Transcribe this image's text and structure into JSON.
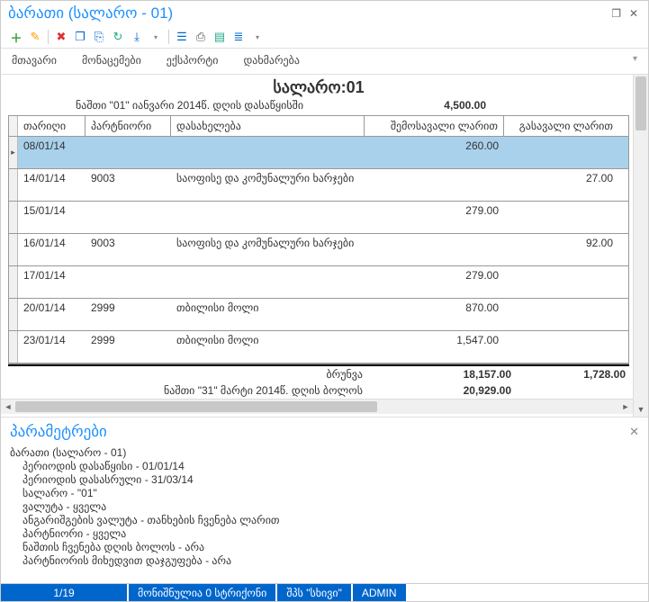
{
  "window": {
    "title": "ბარათი (სალარო - 01)"
  },
  "menu": {
    "main": "მთავარი",
    "data": "მონაცემები",
    "export": "ექსპორტი",
    "help": "დახმარება"
  },
  "report": {
    "title_prefix": "სალარო:",
    "title_value": "01",
    "opening_label": "ნაშთი \"01\" იანვარი 2014წ. დღის დასაწყისში",
    "opening_value": "4,500.00",
    "columns": {
      "date": "თარიღი",
      "partner": "პარტნიორი",
      "name": "დასახელება",
      "income": "შემოსავალი ლარით",
      "outgo": "გასავალი ლარით"
    },
    "rows": [
      {
        "date": "08/01/14",
        "partner": "",
        "name": "",
        "income": "260.00",
        "outgo": "",
        "selected": true,
        "h": "s"
      },
      {
        "date": "14/01/14",
        "partner": "9003",
        "name": "საოფისე და კომუნალური ხარჯები",
        "income": "",
        "outgo": "27.00"
      },
      {
        "date": "15/01/14",
        "partner": "",
        "name": "",
        "income": "279.00",
        "outgo": ""
      },
      {
        "date": "16/01/14",
        "partner": "9003",
        "name": "საოფისე და კომუნალური ხარჯები",
        "income": "",
        "outgo": "92.00"
      },
      {
        "date": "17/01/14",
        "partner": "",
        "name": "",
        "income": "279.00",
        "outgo": ""
      },
      {
        "date": "20/01/14",
        "partner": "2999",
        "name": "თბილისი მოლი",
        "income": "870.00",
        "outgo": ""
      },
      {
        "date": "23/01/14",
        "partner": "2999",
        "name": "თბილისი მოლი",
        "income": "1,547.00",
        "outgo": ""
      }
    ],
    "turnover_label": "ბრუნვა",
    "turnover_in": "18,157.00",
    "turnover_out": "1,728.00",
    "closing_label": "ნაშთი \"31\" მარტი 2014წ. დღის ბოლოს",
    "closing_value": "20,929.00"
  },
  "params": {
    "title": "პარამეტრები",
    "lines": [
      "ბარათი (სალარო - 01)",
      "პერიოდის დასაწყისი  - 01/01/14",
      "პერიოდის დასასრული  - 31/03/14",
      "სალარო  - \"01\"",
      "ვალუტა  - ყველა",
      "ანგარიშგების ვალუტა  - თანხების ჩვენება ლარით",
      "პარტნიორი  - ყველა",
      "ნაშთის ჩვენება დღის ბოლოს  - არა",
      "პარტნიორის მიხედვით დაჯგუფება  - არა"
    ]
  },
  "status": {
    "pos": "1/19",
    "marked": "მონიშნულია 0 სტრიქონი",
    "company": "შპს \"სხივი\"",
    "user": "ADMIN"
  },
  "icons": {
    "add": "＋",
    "edit": "✎",
    "delete": "✖",
    "copy": "❐",
    "dup": "⎘",
    "refresh": "↻",
    "export": "⤓",
    "preview": "☰",
    "print": "⎙",
    "excel": "▤",
    "word": "≣",
    "drop": "▾"
  }
}
